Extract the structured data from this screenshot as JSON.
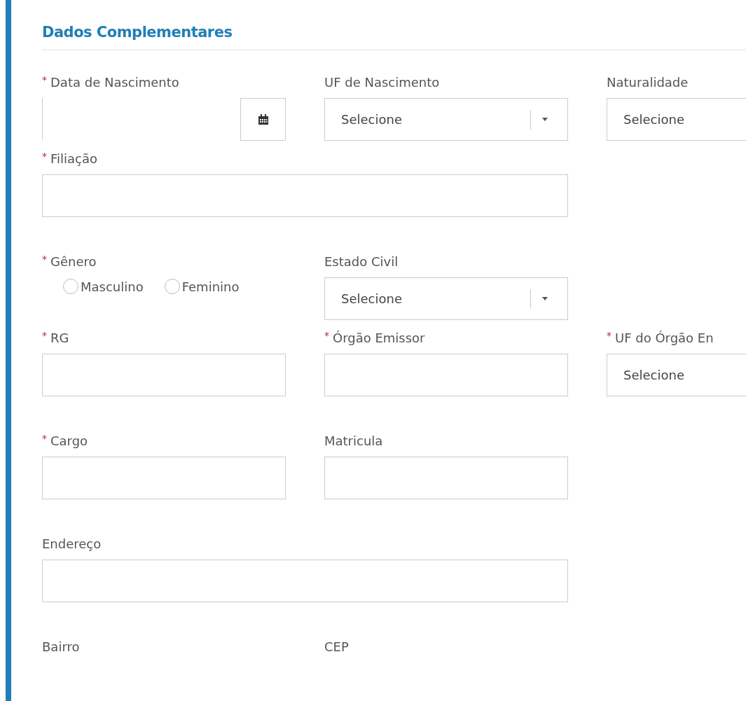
{
  "section": {
    "title": "Dados Complementares"
  },
  "rows": [
    [
      {
        "kind": "date",
        "label": "Data de Nascimento",
        "marker": "*"
      },
      {
        "kind": "select",
        "label": "UF de Nascimento",
        "value": "Selecione"
      },
      {
        "kind": "select",
        "label": "Naturalidade",
        "value": "Selecione"
      }
    ],
    [
      {
        "kind": "text",
        "label": "Filiação",
        "marker": "*",
        "wide": true
      }
    ],
    [
      {
        "kind": "radio",
        "label": "Gênero",
        "marker": "*",
        "options": [
          {
            "label": "Masculino",
            "selected": false
          },
          {
            "label": "Feminino",
            "selected": false
          }
        ]
      },
      {
        "kind": "select",
        "label": "Estado Civil",
        "value": "Selecione"
      }
    ],
    [
      {
        "kind": "text",
        "label": "RG",
        "marker": "*"
      },
      {
        "kind": "text",
        "label": "Órgão Emissor",
        "marker": "*"
      },
      {
        "kind": "select",
        "label": "UF do Órgão En",
        "marker": "*",
        "value": "Selecione"
      }
    ],
    [
      {
        "kind": "text",
        "label": "Cargo",
        "marker": "*"
      },
      {
        "kind": "text",
        "label": "Matricula"
      }
    ],
    [
      {
        "kind": "text",
        "label": "Endereço",
        "wide": true
      }
    ],
    [
      {
        "kind": "label",
        "label": "Bairro"
      },
      {
        "kind": "label",
        "label": "CEP"
      }
    ]
  ]
}
